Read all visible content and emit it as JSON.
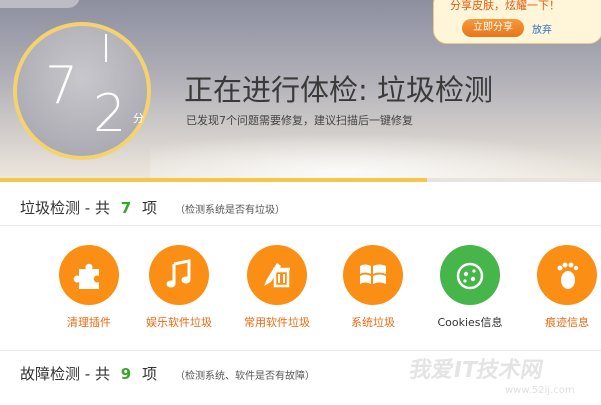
{
  "header": {
    "score_tens": "7",
    "score_ones": "2",
    "score_unit": "分",
    "title": "正在进行体检: 垃圾检测",
    "subtitle": "已发现7个问题需要修复，建议扫描后一键修复",
    "progress_fraction": 0.71,
    "share": {
      "text": "分享皮肤，炫耀一下！",
      "button": "立即分享",
      "dismiss": "放弃"
    }
  },
  "section1": {
    "title_prefix": "垃圾检测 - 共",
    "count": "7",
    "title_suffix": "项",
    "desc": "（检测系统是否有垃圾）",
    "items": [
      {
        "label": "清理插件",
        "icon": "puzzle-icon"
      },
      {
        "label": "娱乐软件垃圾",
        "icon": "music-note-icon"
      },
      {
        "label": "常用软件垃圾",
        "icon": "pen-trash-icon"
      },
      {
        "label": "系统垃圾",
        "icon": "windows-icon"
      },
      {
        "label": "Cookies信息",
        "icon": "cookie-icon"
      },
      {
        "label": "痕迹信息",
        "icon": "footprint-icon"
      }
    ]
  },
  "section2": {
    "title_prefix": "故障检测 - 共",
    "count": "9",
    "title_suffix": "项",
    "desc": "（检测系统、软件是否有故障）"
  },
  "colors": {
    "accent_orange": "#fb8f16",
    "accent_green": "#46b54a",
    "count_green": "#3aa52b",
    "ring_yellow": "#f4d36e"
  },
  "watermark": {
    "text": "我爱IT技术网",
    "url": "www.52ij.com"
  }
}
